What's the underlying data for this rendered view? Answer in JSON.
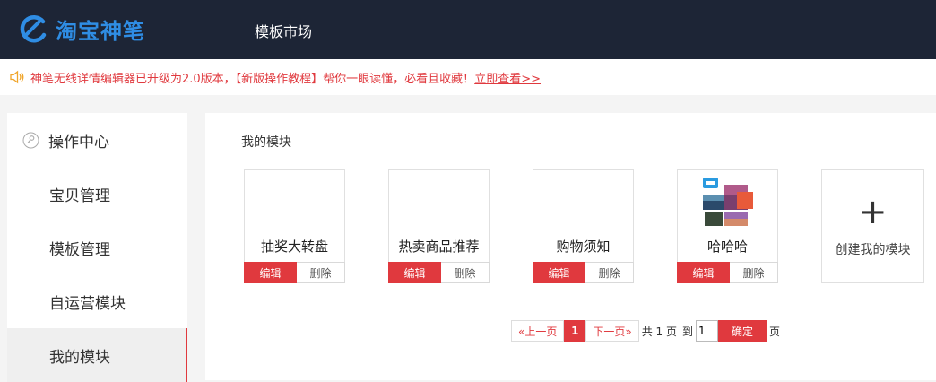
{
  "header": {
    "logo_text": "淘宝神笔",
    "nav_title": "模板市场"
  },
  "notice": {
    "text": "神笔无线详情编辑器已升级为2.0版本，【新版操作教程】帮你一眼读懂，必看且收藏！",
    "link": "立即查看>>"
  },
  "sidebar": {
    "header": "操作中心",
    "items": [
      {
        "label": "宝贝管理"
      },
      {
        "label": "模板管理"
      },
      {
        "label": "自运营模块"
      },
      {
        "label": "我的模块"
      }
    ],
    "active_index": 3
  },
  "main": {
    "section_title": "我的模块",
    "modules": [
      {
        "name": "抽奖大转盘",
        "edit": "编辑",
        "delete": "删除"
      },
      {
        "name": "热卖商品推荐",
        "edit": "编辑",
        "delete": "删除"
      },
      {
        "name": "购物须知",
        "edit": "编辑",
        "delete": "删除"
      },
      {
        "name": "哈哈哈",
        "edit": "编辑",
        "delete": "删除"
      }
    ],
    "create": {
      "icon": "+",
      "label": "创建我的模块"
    }
  },
  "pagination": {
    "prev": "«上一页",
    "current": "1",
    "next": "下一页»",
    "total_text": "共 1 页",
    "goto_label": "到",
    "input_value": "1",
    "confirm": "确定",
    "page_suffix": "页"
  },
  "colors": {
    "topbar": "#1d2536",
    "brand_blue": "#2f8de4",
    "accent_red": "#e0393e"
  }
}
